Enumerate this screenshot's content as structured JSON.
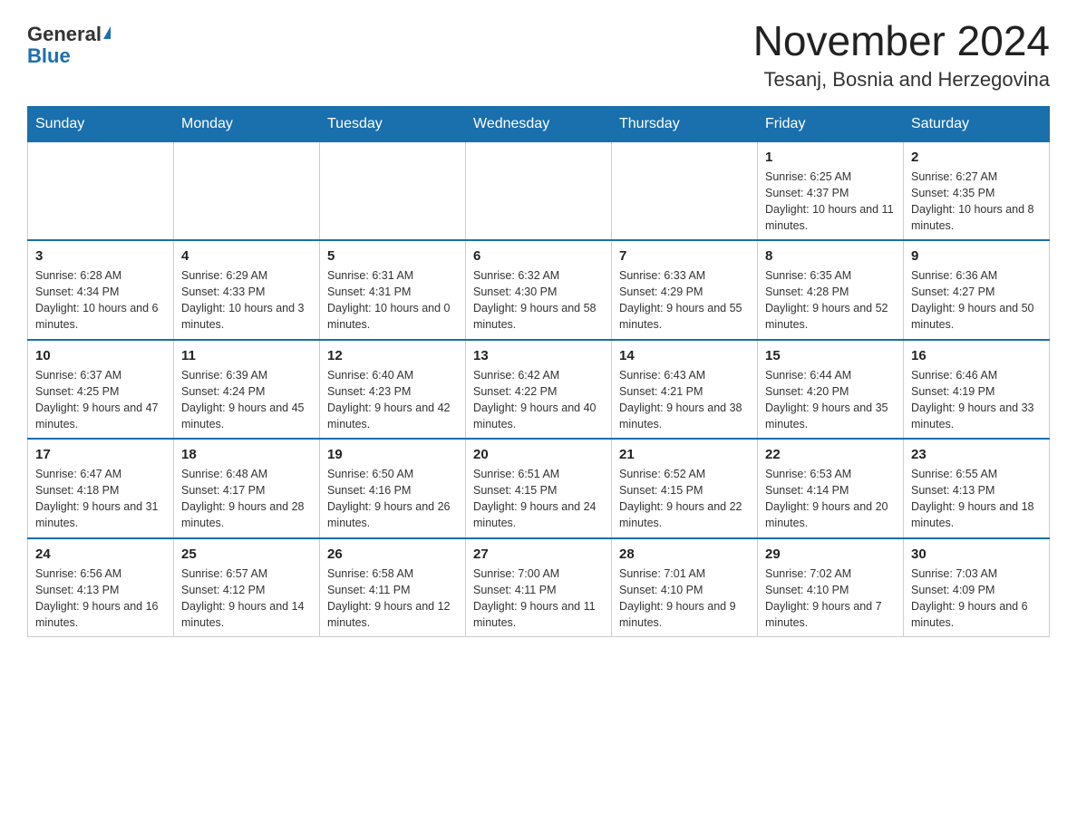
{
  "header": {
    "logo_general": "General",
    "logo_blue": "Blue",
    "month_title": "November 2024",
    "location": "Tesanj, Bosnia and Herzegovina"
  },
  "weekdays": [
    "Sunday",
    "Monday",
    "Tuesday",
    "Wednesday",
    "Thursday",
    "Friday",
    "Saturday"
  ],
  "weeks": [
    [
      {
        "day": "",
        "sunrise": "",
        "sunset": "",
        "daylight": ""
      },
      {
        "day": "",
        "sunrise": "",
        "sunset": "",
        "daylight": ""
      },
      {
        "day": "",
        "sunrise": "",
        "sunset": "",
        "daylight": ""
      },
      {
        "day": "",
        "sunrise": "",
        "sunset": "",
        "daylight": ""
      },
      {
        "day": "",
        "sunrise": "",
        "sunset": "",
        "daylight": ""
      },
      {
        "day": "1",
        "sunrise": "Sunrise: 6:25 AM",
        "sunset": "Sunset: 4:37 PM",
        "daylight": "Daylight: 10 hours and 11 minutes."
      },
      {
        "day": "2",
        "sunrise": "Sunrise: 6:27 AM",
        "sunset": "Sunset: 4:35 PM",
        "daylight": "Daylight: 10 hours and 8 minutes."
      }
    ],
    [
      {
        "day": "3",
        "sunrise": "Sunrise: 6:28 AM",
        "sunset": "Sunset: 4:34 PM",
        "daylight": "Daylight: 10 hours and 6 minutes."
      },
      {
        "day": "4",
        "sunrise": "Sunrise: 6:29 AM",
        "sunset": "Sunset: 4:33 PM",
        "daylight": "Daylight: 10 hours and 3 minutes."
      },
      {
        "day": "5",
        "sunrise": "Sunrise: 6:31 AM",
        "sunset": "Sunset: 4:31 PM",
        "daylight": "Daylight: 10 hours and 0 minutes."
      },
      {
        "day": "6",
        "sunrise": "Sunrise: 6:32 AM",
        "sunset": "Sunset: 4:30 PM",
        "daylight": "Daylight: 9 hours and 58 minutes."
      },
      {
        "day": "7",
        "sunrise": "Sunrise: 6:33 AM",
        "sunset": "Sunset: 4:29 PM",
        "daylight": "Daylight: 9 hours and 55 minutes."
      },
      {
        "day": "8",
        "sunrise": "Sunrise: 6:35 AM",
        "sunset": "Sunset: 4:28 PM",
        "daylight": "Daylight: 9 hours and 52 minutes."
      },
      {
        "day": "9",
        "sunrise": "Sunrise: 6:36 AM",
        "sunset": "Sunset: 4:27 PM",
        "daylight": "Daylight: 9 hours and 50 minutes."
      }
    ],
    [
      {
        "day": "10",
        "sunrise": "Sunrise: 6:37 AM",
        "sunset": "Sunset: 4:25 PM",
        "daylight": "Daylight: 9 hours and 47 minutes."
      },
      {
        "day": "11",
        "sunrise": "Sunrise: 6:39 AM",
        "sunset": "Sunset: 4:24 PM",
        "daylight": "Daylight: 9 hours and 45 minutes."
      },
      {
        "day": "12",
        "sunrise": "Sunrise: 6:40 AM",
        "sunset": "Sunset: 4:23 PM",
        "daylight": "Daylight: 9 hours and 42 minutes."
      },
      {
        "day": "13",
        "sunrise": "Sunrise: 6:42 AM",
        "sunset": "Sunset: 4:22 PM",
        "daylight": "Daylight: 9 hours and 40 minutes."
      },
      {
        "day": "14",
        "sunrise": "Sunrise: 6:43 AM",
        "sunset": "Sunset: 4:21 PM",
        "daylight": "Daylight: 9 hours and 38 minutes."
      },
      {
        "day": "15",
        "sunrise": "Sunrise: 6:44 AM",
        "sunset": "Sunset: 4:20 PM",
        "daylight": "Daylight: 9 hours and 35 minutes."
      },
      {
        "day": "16",
        "sunrise": "Sunrise: 6:46 AM",
        "sunset": "Sunset: 4:19 PM",
        "daylight": "Daylight: 9 hours and 33 minutes."
      }
    ],
    [
      {
        "day": "17",
        "sunrise": "Sunrise: 6:47 AM",
        "sunset": "Sunset: 4:18 PM",
        "daylight": "Daylight: 9 hours and 31 minutes."
      },
      {
        "day": "18",
        "sunrise": "Sunrise: 6:48 AM",
        "sunset": "Sunset: 4:17 PM",
        "daylight": "Daylight: 9 hours and 28 minutes."
      },
      {
        "day": "19",
        "sunrise": "Sunrise: 6:50 AM",
        "sunset": "Sunset: 4:16 PM",
        "daylight": "Daylight: 9 hours and 26 minutes."
      },
      {
        "day": "20",
        "sunrise": "Sunrise: 6:51 AM",
        "sunset": "Sunset: 4:15 PM",
        "daylight": "Daylight: 9 hours and 24 minutes."
      },
      {
        "day": "21",
        "sunrise": "Sunrise: 6:52 AM",
        "sunset": "Sunset: 4:15 PM",
        "daylight": "Daylight: 9 hours and 22 minutes."
      },
      {
        "day": "22",
        "sunrise": "Sunrise: 6:53 AM",
        "sunset": "Sunset: 4:14 PM",
        "daylight": "Daylight: 9 hours and 20 minutes."
      },
      {
        "day": "23",
        "sunrise": "Sunrise: 6:55 AM",
        "sunset": "Sunset: 4:13 PM",
        "daylight": "Daylight: 9 hours and 18 minutes."
      }
    ],
    [
      {
        "day": "24",
        "sunrise": "Sunrise: 6:56 AM",
        "sunset": "Sunset: 4:13 PM",
        "daylight": "Daylight: 9 hours and 16 minutes."
      },
      {
        "day": "25",
        "sunrise": "Sunrise: 6:57 AM",
        "sunset": "Sunset: 4:12 PM",
        "daylight": "Daylight: 9 hours and 14 minutes."
      },
      {
        "day": "26",
        "sunrise": "Sunrise: 6:58 AM",
        "sunset": "Sunset: 4:11 PM",
        "daylight": "Daylight: 9 hours and 12 minutes."
      },
      {
        "day": "27",
        "sunrise": "Sunrise: 7:00 AM",
        "sunset": "Sunset: 4:11 PM",
        "daylight": "Daylight: 9 hours and 11 minutes."
      },
      {
        "day": "28",
        "sunrise": "Sunrise: 7:01 AM",
        "sunset": "Sunset: 4:10 PM",
        "daylight": "Daylight: 9 hours and 9 minutes."
      },
      {
        "day": "29",
        "sunrise": "Sunrise: 7:02 AM",
        "sunset": "Sunset: 4:10 PM",
        "daylight": "Daylight: 9 hours and 7 minutes."
      },
      {
        "day": "30",
        "sunrise": "Sunrise: 7:03 AM",
        "sunset": "Sunset: 4:09 PM",
        "daylight": "Daylight: 9 hours and 6 minutes."
      }
    ]
  ]
}
